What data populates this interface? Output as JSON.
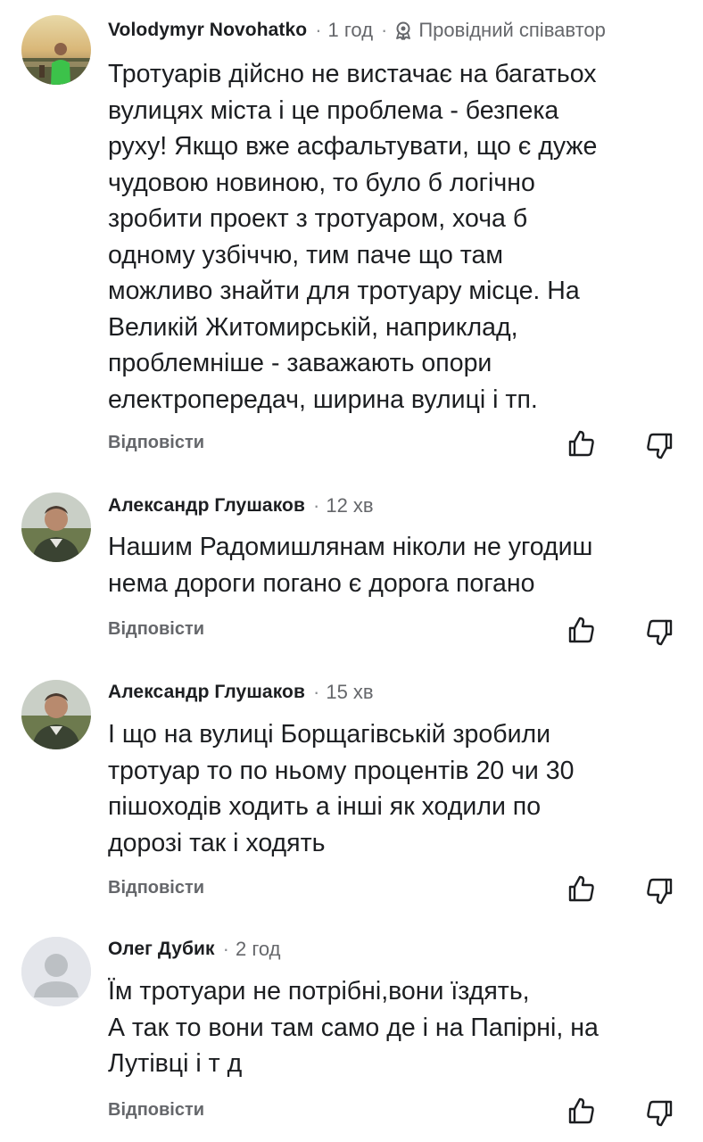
{
  "comments": [
    {
      "author": "Volodymyr Novohatko",
      "time": "1 год",
      "badge": "Провідний співавтор",
      "text": "Тротуарів дійсно не вистачає на багатьох\nвулицях міста і це проблема - безпека\nруху! Якщо вже асфальтувати, що є дуже\nчудовою новиною, то було б логічно\nзробити проект з тротуаром, хоча б\nодному узбіччю, тим паче що там\nможливо знайти для тротуару місце. На\nВеликій Житомирській, наприклад,\nпроблемніше - заважають опори\nелектропередач, ширина вулиці і тп.",
      "reply": "Відповісти",
      "avatar": "photo-avatar"
    },
    {
      "author": "Александр Глушаков",
      "time": "12 хв",
      "text": "Нашим Радомишлянам ніколи не угодиш\nнема дороги погано є дорога погано",
      "reply": "Відповісти",
      "avatar": "photo-avatar"
    },
    {
      "author": "Александр Глушаков",
      "time": "15 хв",
      "text": "І що на вулиці Борщагівській зробили\nтротуар то по ньому процентів 20 чи 30\nпішоходів ходить а інші як ходили по\nдорозі так і ходять",
      "reply": "Відповісти",
      "avatar": "photo-avatar"
    },
    {
      "author": "Олег Дубик",
      "time": "2 год",
      "text": "Їм тротуари не потрібні,вони їздять,\nА так то вони там само де і на Папірні, на\nЛутівці і т д",
      "reply": "Відповісти",
      "avatar": "default-user-icon"
    }
  ],
  "separator": "·",
  "icons": {
    "like": "thumbs-up-icon",
    "dislike": "thumbs-down-icon",
    "badge": "contributor-badge-icon"
  },
  "colors": {
    "text": "#1c1e21",
    "secondary": "#65676b",
    "background": "#ffffff"
  }
}
